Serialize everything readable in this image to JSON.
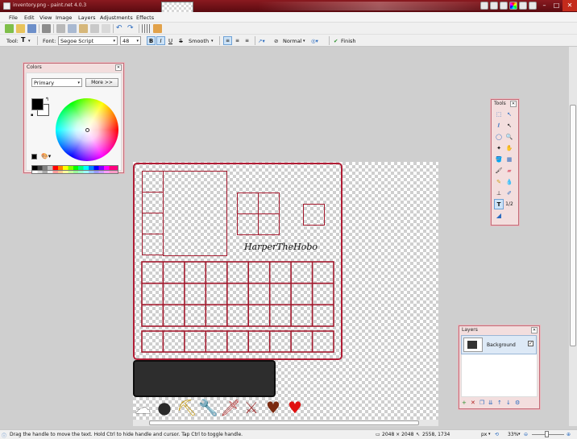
{
  "titlebar": {
    "title": "inventory.png - paint.net 4.0.3"
  },
  "menu": [
    "File",
    "Edit",
    "View",
    "Image",
    "Layers",
    "Adjustments",
    "Effects"
  ],
  "text_toolbar": {
    "tool_label": "Tool:",
    "font_label": "Font:",
    "font_value": "Segoe Script",
    "size_value": "48",
    "bold": "B",
    "italic": "I",
    "underline": "U",
    "strike": "S",
    "antialias": "Smooth",
    "blend": "Normal",
    "finish": "Finish"
  },
  "colors_panel": {
    "title": "Colors",
    "mode": "Primary",
    "more_button": "More >>",
    "primary_color": "#000000",
    "secondary_color": "#ffffff"
  },
  "tools_panel": {
    "title": "Tools"
  },
  "canvas": {
    "text": "HarperTheHobo",
    "slot_color": "#b01d35",
    "hotbar_color": "#2d2d2d"
  },
  "layers_panel": {
    "title": "Layers",
    "layers": [
      {
        "name": "Background",
        "visible": true
      }
    ]
  },
  "status": {
    "hint": "Drag the handle to move the text. Hold Ctrl to hide handle and cursor. Tap Ctrl to toggle handle.",
    "image_size": "2048 × 2048",
    "cursor_pos": "2558, 1734",
    "units": "px",
    "zoom": "33%"
  }
}
